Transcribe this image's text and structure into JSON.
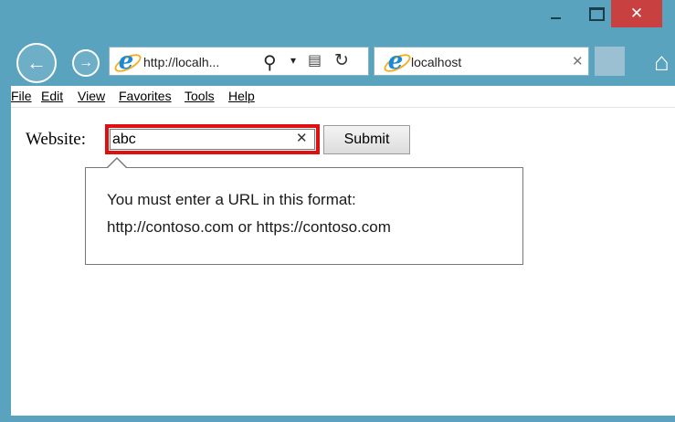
{
  "window": {
    "minimize_icon": "minimize-icon",
    "maximize_icon": "maximize-icon",
    "close_glyph": "✕",
    "frame_color": "#5aa3bf",
    "close_color": "#c84040"
  },
  "nav": {
    "back_glyph": "←",
    "forward_glyph": "→",
    "address_text": "http://localh...",
    "search_glyph": "⚲",
    "dropdown_glyph": "▾",
    "compat_glyph": "▤",
    "refresh_glyph": "↻"
  },
  "tab": {
    "title": "localhost",
    "close_glyph": "✕"
  },
  "home_glyph": "⌂",
  "menu": {
    "items": [
      "File",
      "Edit",
      "View",
      "Favorites",
      "Tools",
      "Help"
    ]
  },
  "form": {
    "label": "Website:",
    "value": "abc",
    "clear_glyph": "✕",
    "submit_label": "Submit",
    "highlight_color": "#e01010"
  },
  "tooltip": {
    "line1": "You must enter a URL in this format:",
    "line2": "http://contoso.com or https://contoso.com"
  }
}
